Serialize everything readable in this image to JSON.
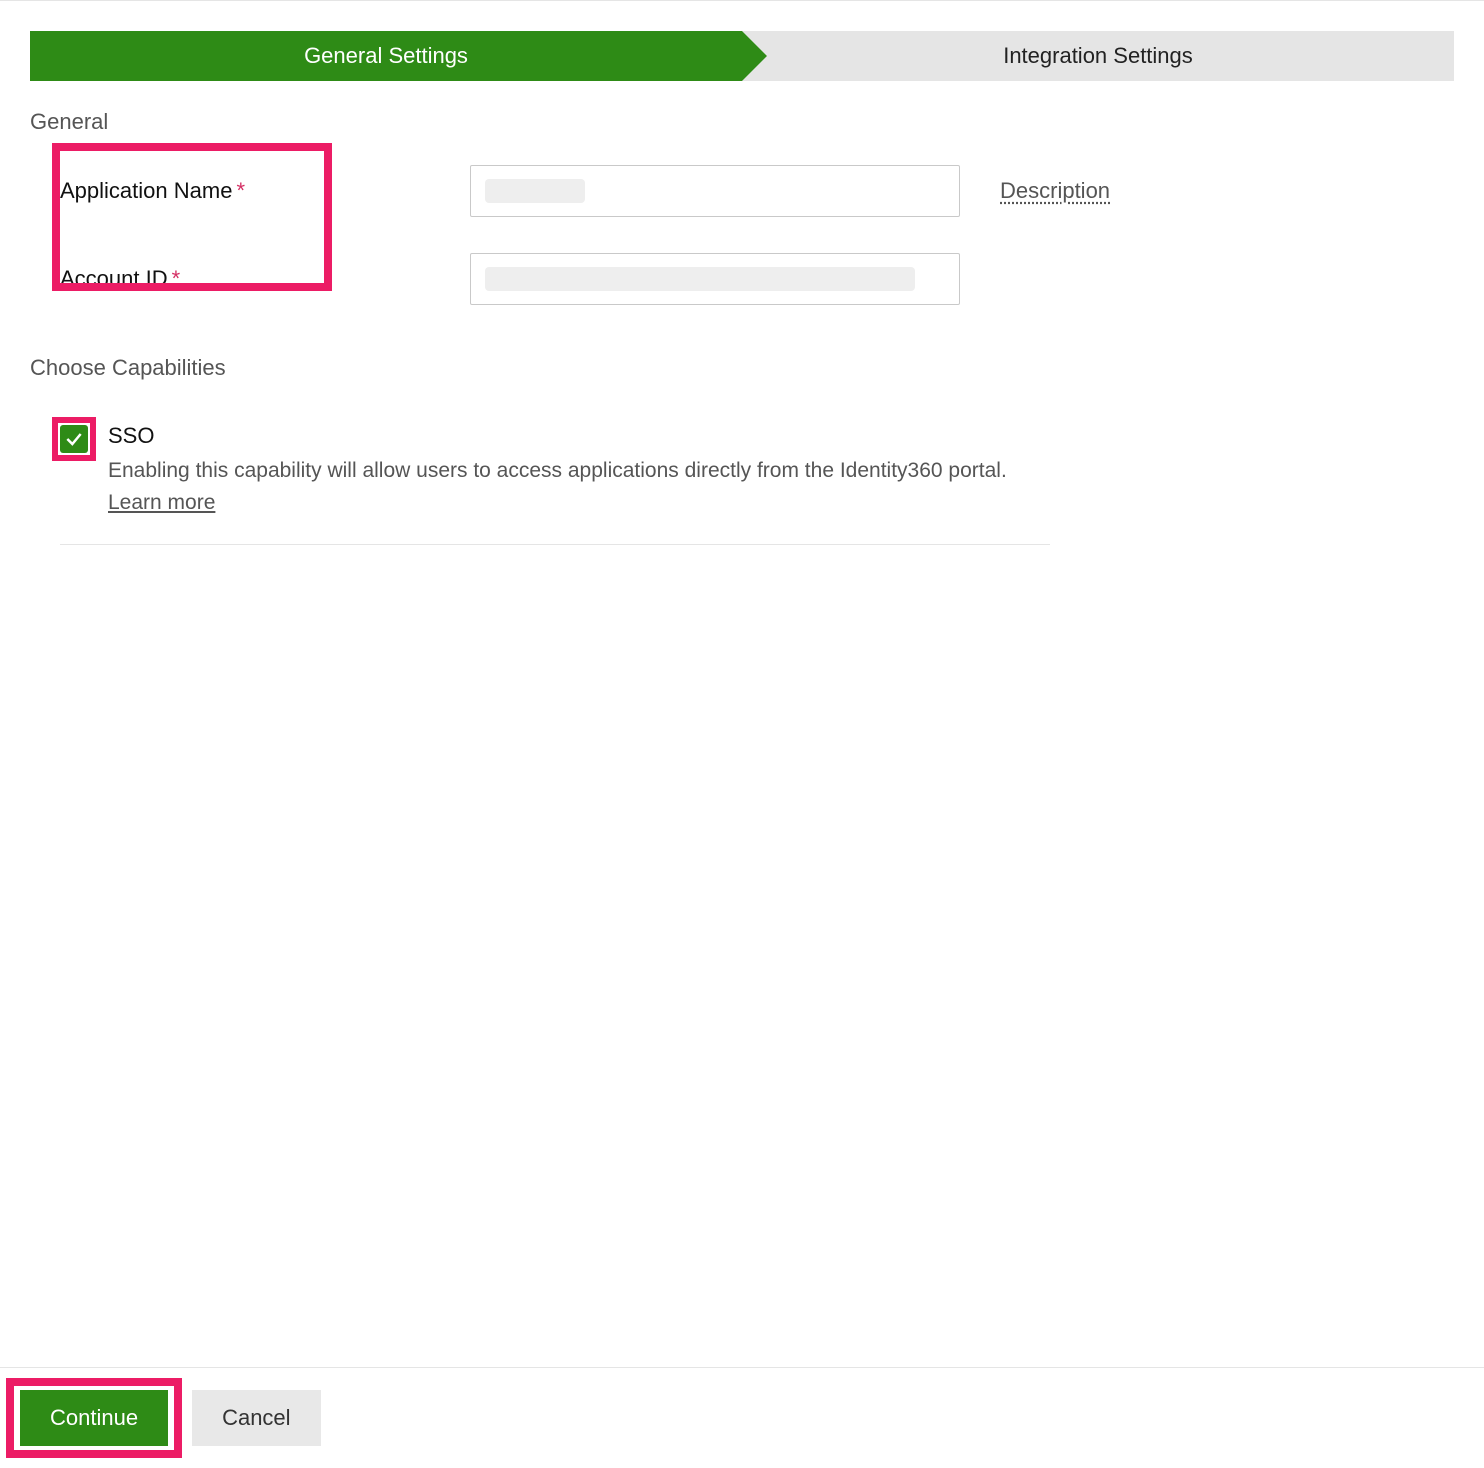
{
  "colors": {
    "accent": "#2e8b16",
    "highlight": "#ec1c65"
  },
  "steps": {
    "active_index": 0,
    "items": [
      "General Settings",
      "Integration Settings"
    ]
  },
  "general": {
    "heading": "General",
    "app_name_label": "Application Name",
    "app_name_value": "",
    "account_id_label": "Account ID",
    "account_id_value": "",
    "required_marker": "*",
    "description_link": "Description"
  },
  "capabilities": {
    "heading": "Choose Capabilities",
    "sso": {
      "checked": true,
      "title": "SSO",
      "description": "Enabling this capability will allow users to access applications directly from the Identity360 portal. ",
      "learn_more": "Learn more"
    }
  },
  "footer": {
    "continue_label": "Continue",
    "cancel_label": "Cancel"
  }
}
